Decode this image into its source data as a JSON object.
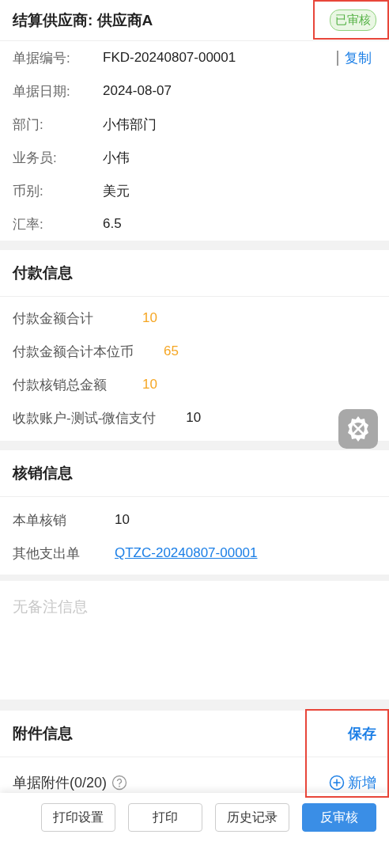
{
  "header": {
    "title": "结算供应商: 供应商A",
    "status": "已审核",
    "highlighted": true
  },
  "fields": [
    {
      "label": "单据编号:",
      "value": "FKD-20240807-00001",
      "action": "复制"
    },
    {
      "label": "单据日期:",
      "value": "2024-08-07"
    },
    {
      "label": "部门:",
      "value": "小伟部门"
    },
    {
      "label": "业务员:",
      "value": "小伟"
    },
    {
      "label": "币别:",
      "value": "美元"
    },
    {
      "label": "汇率:",
      "value": "6.5"
    }
  ],
  "payment": {
    "title": "付款信息",
    "rows": [
      {
        "label": "付款金额合计",
        "value": "10",
        "kind": "amount"
      },
      {
        "label": "付款金额合计本位币",
        "value": "65",
        "kind": "amount"
      },
      {
        "label": "付款核销总金额",
        "value": "10",
        "kind": "amount"
      },
      {
        "label": "收款账户-测试-微信支付",
        "value": "10",
        "kind": "plain"
      }
    ]
  },
  "writeoff": {
    "title": "核销信息",
    "rows": [
      {
        "label": "本单核销",
        "value": "10",
        "kind": "plain"
      },
      {
        "label": "其他支出单",
        "value": "QTZC-20240807-00001",
        "kind": "link"
      }
    ]
  },
  "remark": {
    "placeholder": "无备注信息"
  },
  "attachments": {
    "title": "附件信息",
    "save": "保存",
    "label": "单据附件(0/20)",
    "add": "新增",
    "highlighted": true
  },
  "footer": {
    "buttons": [
      {
        "label": "打印设置",
        "primary": false
      },
      {
        "label": "打印",
        "primary": false
      },
      {
        "label": "历史记录",
        "primary": false
      },
      {
        "label": "反审核",
        "primary": true
      }
    ]
  }
}
